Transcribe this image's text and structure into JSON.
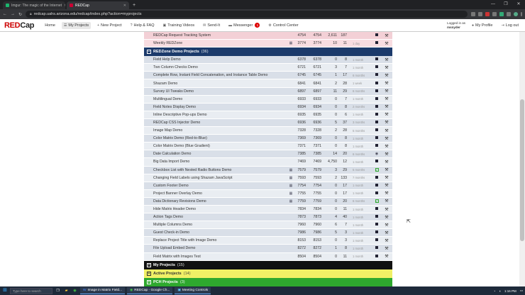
{
  "browser": {
    "tabs": [
      {
        "title": "Imgur: The magic of the Internet"
      },
      {
        "title": "REDCap"
      }
    ],
    "new_tab": "+",
    "url": "redcap.uahs.arizona.edu/redcap/index.php?action=myprojects",
    "window_controls": [
      "—",
      "❐",
      "✕"
    ]
  },
  "nav": {
    "logo_a": "RED",
    "logo_b": "Cap",
    "items": [
      {
        "label": "Home"
      },
      {
        "label": "My Projects"
      },
      {
        "label": "New Project"
      },
      {
        "label": "Help & FAQ"
      },
      {
        "label": "Training Videos"
      },
      {
        "label": "Send-It"
      },
      {
        "label": "Messenger"
      },
      {
        "label": "Control Center"
      }
    ],
    "messenger_badge": "1",
    "logged_in_as": "Logged in as",
    "username": "msnyder",
    "my_profile": "My Profile",
    "log_out": "Log out"
  },
  "top_rows": [
    {
      "name": "REDCap Request Tracking System",
      "a": "4754",
      "b": "4754",
      "c": "2,611",
      "d": "187",
      "date": "",
      "cal": "",
      "status": "sq"
    },
    {
      "name": "Weekly REDZone",
      "a": "3774",
      "b": "3774",
      "c": "10",
      "d": "11",
      "date": "1 day",
      "cal": "cal",
      "status": "sq"
    }
  ],
  "redzone_header": {
    "title": "REDZone Demo Projects",
    "count": "(36)"
  },
  "demo_rows": [
    {
      "name": "Field Help Demo",
      "a": "6378",
      "b": "6378",
      "c": "0",
      "d": "8",
      "date": "1 month",
      "cal": "",
      "status": "sq"
    },
    {
      "name": "Two Column Checks Demo",
      "a": "6721",
      "b": "6721",
      "c": "3",
      "d": "7",
      "date": "1 month",
      "cal": "",
      "status": "sq"
    },
    {
      "name": "Complete Row, Instant Field Concatenation, and Instance Table Demo",
      "a": "6745",
      "b": "6745",
      "c": "1",
      "d": "17",
      "date": "6 months",
      "cal": "",
      "status": "sq"
    },
    {
      "name": "Shazam Demo",
      "a": "6841",
      "b": "6841",
      "c": "2",
      "d": "28",
      "date": "1 week",
      "cal": "",
      "status": "sq"
    },
    {
      "name": "Survey UI Tweaks Demo",
      "a": "6897",
      "b": "6897",
      "c": "11",
      "d": "29",
      "date": "6 months",
      "cal": "",
      "status": "sq"
    },
    {
      "name": "Multilingual Demo",
      "a": "6933",
      "b": "6933",
      "c": "0",
      "d": "7",
      "date": "1 month",
      "cal": "",
      "status": "sq"
    },
    {
      "name": "Field Notes Display Demo",
      "a": "6934",
      "b": "6934",
      "c": "0",
      "d": "8",
      "date": "2 months",
      "cal": "",
      "status": "sq"
    },
    {
      "name": "Inline Descriptive Pop-ups Demo",
      "a": "6935",
      "b": "6935",
      "c": "0",
      "d": "6",
      "date": "1 month",
      "cal": "",
      "status": "sq"
    },
    {
      "name": "REDCap CSS Injector Demo",
      "a": "6936",
      "b": "6936",
      "c": "5",
      "d": "37",
      "date": "3 months",
      "cal": "",
      "status": "sq"
    },
    {
      "name": "Image Map Demo",
      "a": "7328",
      "b": "7328",
      "c": "2",
      "d": "28",
      "date": "5 months",
      "cal": "",
      "status": "sq"
    },
    {
      "name": "Color Matrix Demo (Red-to-Blue)",
      "a": "7369",
      "b": "7369",
      "c": "0",
      "d": "8",
      "date": "1 month",
      "cal": "",
      "status": "sq"
    },
    {
      "name": "Color Matrix Demo (Blue Gradient)",
      "a": "7371",
      "b": "7371",
      "c": "0",
      "d": "8",
      "date": "1 month",
      "cal": "",
      "status": "sq"
    },
    {
      "name": "Date Calculation Demo",
      "a": "7385",
      "b": "7385",
      "c": "14",
      "d": "20",
      "date": "6 months",
      "cal": "",
      "status": "gl"
    },
    {
      "name": "Big Data Import Demo",
      "a": "7469",
      "b": "7469",
      "c": "4,750",
      "d": "12",
      "date": "1 month",
      "cal": "",
      "status": "sq"
    },
    {
      "name": "Checkbox List with Nested Radio Buttons Demo",
      "a": "7579",
      "b": "7579",
      "c": "3",
      "d": "29",
      "date": "5 months",
      "cal": "cal",
      "status": "gr"
    },
    {
      "name": "Changing Field Labels using Shazam JavaScript",
      "a": "7593",
      "b": "7593",
      "c": "2",
      "d": "133",
      "date": "7 months",
      "cal": "cal",
      "status": "sq"
    },
    {
      "name": "Custom Footer Demo",
      "a": "7754",
      "b": "7754",
      "c": "0",
      "d": "17",
      "date": "1 month",
      "cal": "cal",
      "status": "sq"
    },
    {
      "name": "Project Banner Overlay Demo",
      "a": "7755",
      "b": "7755",
      "c": "0",
      "d": "17",
      "date": "1 month",
      "cal": "cal",
      "status": "sq"
    },
    {
      "name": "Data Dictionary Revisions Demo",
      "a": "7759",
      "b": "7759",
      "c": "0",
      "d": "20",
      "date": "6 months",
      "cal": "cal",
      "status": "gr"
    },
    {
      "name": "Hide Matrix Header Demo",
      "a": "7834",
      "b": "7834",
      "c": "0",
      "d": "11",
      "date": "1 month",
      "cal": "",
      "status": "sq"
    },
    {
      "name": "Action Tags Demo",
      "a": "7873",
      "b": "7873",
      "c": "4",
      "d": "40",
      "date": "1 month",
      "cal": "",
      "status": "sq"
    },
    {
      "name": "Multiple Columns Demo",
      "a": "7960",
      "b": "7960",
      "c": "6",
      "d": "7",
      "date": "1 month",
      "cal": "",
      "status": "sq"
    },
    {
      "name": "Guest Check-in Demo",
      "a": "7986",
      "b": "7986",
      "c": "5",
      "d": "3",
      "date": "1 month",
      "cal": "",
      "status": "sq"
    },
    {
      "name": "Replace Project Title with Image Demo",
      "a": "8153",
      "b": "8153",
      "c": "0",
      "d": "3",
      "date": "1 month",
      "cal": "",
      "status": "sq"
    },
    {
      "name": "File Upload Embed Demo",
      "a": "8272",
      "b": "8272",
      "c": "1",
      "d": "8",
      "date": "1 month",
      "cal": "",
      "status": "sq"
    },
    {
      "name": "Field Matrix with Images Test",
      "a": "8504",
      "b": "8504",
      "c": "0",
      "d": "11",
      "date": "1 month",
      "cal": "",
      "status": "sq"
    }
  ],
  "folders": [
    {
      "title": "My Projects",
      "count": "(15)",
      "style": "black"
    },
    {
      "title": "Active Projects",
      "count": "(14)",
      "style": "yellow"
    },
    {
      "title": "PCH Projects",
      "count": "(3)",
      "style": "green"
    }
  ],
  "taskbar": {
    "search": "Type here to search",
    "apps": [
      {
        "label": "Image in Matrix Field..."
      },
      {
        "label": "REDCap - Google Ch..."
      },
      {
        "label": "Meeting Controls"
      }
    ],
    "time": "1:16 PM"
  },
  "colors": {
    "redzone_header": "#1b3a6b",
    "top_rows": "#f3d0d6",
    "yellow_folder": "#f0f066",
    "green_folder": "#2ea82e"
  }
}
